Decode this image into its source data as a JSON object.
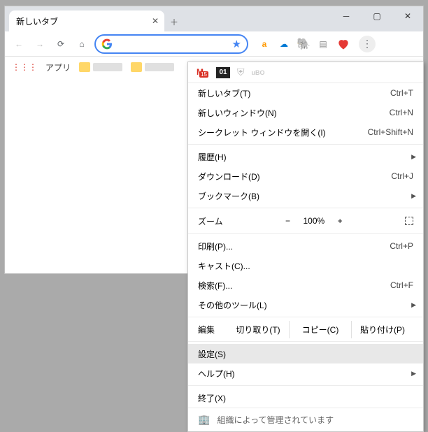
{
  "window": {
    "tab_title": "新しいタブ"
  },
  "bookmarks_bar": {
    "apps_label": "アプリ"
  },
  "menu": {
    "new_tab": "新しいタブ(T)",
    "new_tab_sc": "Ctrl+T",
    "new_window": "新しいウィンドウ(N)",
    "new_window_sc": "Ctrl+N",
    "incognito": "シークレット ウィンドウを開く(I)",
    "incognito_sc": "Ctrl+Shift+N",
    "history": "履歴(H)",
    "downloads": "ダウンロード(D)",
    "downloads_sc": "Ctrl+J",
    "bookmarks": "ブックマーク(B)",
    "zoom_label": "ズーム",
    "zoom_value": "100%",
    "zoom_minus": "−",
    "zoom_plus": "+",
    "print": "印刷(P)...",
    "print_sc": "Ctrl+P",
    "cast": "キャスト(C)...",
    "find": "検索(F)...",
    "find_sc": "Ctrl+F",
    "more_tools": "その他のツール(L)",
    "edit_label": "編集",
    "cut": "切り取り(T)",
    "copy": "コピー(C)",
    "paste": "貼り付け(P)",
    "settings": "設定(S)",
    "help": "ヘルプ(H)",
    "exit": "終了(X)",
    "managed": "組織によって管理されています"
  }
}
